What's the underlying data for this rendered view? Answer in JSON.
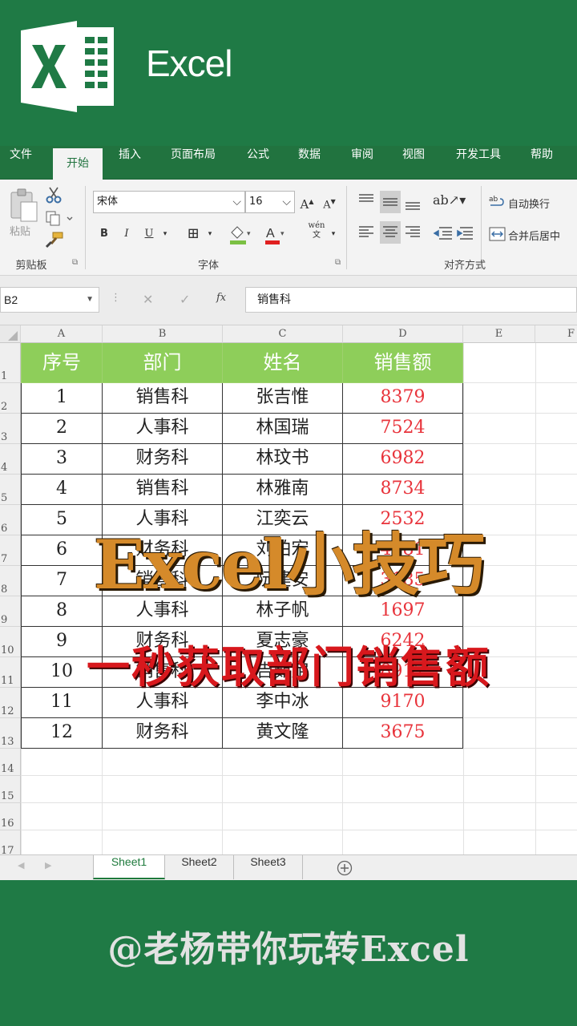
{
  "app": {
    "title": "Excel"
  },
  "ribbon_tabs": [
    "文件",
    "开始",
    "插入",
    "页面布局",
    "公式",
    "数据",
    "审阅",
    "视图",
    "开发工具",
    "帮助"
  ],
  "ribbon": {
    "clipboard_group": "剪贴板",
    "paste_label": "粘贴",
    "font_group": "字体",
    "font_name": "宋体",
    "font_size": "16",
    "bold": "B",
    "italic": "I",
    "underline": "U",
    "phonetic": "wén\n文",
    "align_group": "对齐方式",
    "wrap_text": "自动换行",
    "merge_center": "合并后居中"
  },
  "formula_bar": {
    "name_box": "B2",
    "fx": "fx",
    "content": "销售科"
  },
  "columns": [
    "A",
    "B",
    "C",
    "D",
    "E",
    "F"
  ],
  "row_numbers": [
    "1",
    "2",
    "3",
    "4",
    "5",
    "6",
    "7",
    "8",
    "9",
    "10",
    "11",
    "12",
    "13",
    "14",
    "15",
    "16",
    "17"
  ],
  "table": {
    "headers": [
      "序号",
      "部门",
      "姓名",
      "销售额"
    ],
    "rows": [
      [
        "1",
        "销售科",
        "张吉惟",
        "8379"
      ],
      [
        "2",
        "人事科",
        "林国瑞",
        "7524"
      ],
      [
        "3",
        "财务科",
        "林玟书",
        "6982"
      ],
      [
        "4",
        "销售科",
        "林雅南",
        "8734"
      ],
      [
        "5",
        "人事科",
        "江奕云",
        "2532"
      ],
      [
        "6",
        "财务科",
        "刘柏宏",
        "4281"
      ],
      [
        "7",
        "销售科",
        "阮建安",
        "3185"
      ],
      [
        "8",
        "人事科",
        "林子帆",
        "1697"
      ],
      [
        "9",
        "财务科",
        "夏志豪",
        "6242"
      ],
      [
        "10",
        "销售科",
        "吉茹定",
        "8917"
      ],
      [
        "11",
        "人事科",
        "李中冰",
        "9170"
      ],
      [
        "12",
        "财务科",
        "黄文隆",
        "3675"
      ]
    ]
  },
  "sheets": [
    "Sheet1",
    "Sheet2",
    "Sheet3"
  ],
  "overlay": {
    "title": "Excel小技巧",
    "subtitle": "一秒获取部门销售额"
  },
  "credit": "@老杨带你玩转Excel",
  "colors": {
    "brand": "#1f7a45",
    "header_fill": "#8ece5a",
    "sales_red": "#e8333b"
  }
}
